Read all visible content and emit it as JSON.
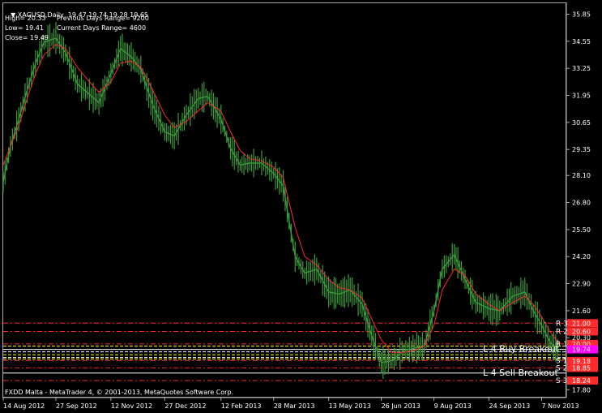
{
  "header": {
    "symbol_line": "XAGUSD,Daily  19.47 19.74 19.28 19.65",
    "high": "High= 20.33",
    "low": "Low= 19.41",
    "close": "Close= 19.49",
    "prev_range": "Previous Days Range= 9200",
    "curr_range": "Current Days Range= 4600"
  },
  "footer": {
    "credit": "FXDD Malta - MetaTrader 4, © 2001-2013, MetaQuotes Software Corp."
  },
  "colors": {
    "background": "#000000",
    "candle": "#3a9a3a",
    "ma": "#ff2a2a",
    "resistance": "#ff2a2a",
    "support": "#ff2a2a",
    "pivot_yellow": "#ffff00",
    "pivot_white": "#ffffff",
    "magenta": "#ff00ff"
  },
  "chart_data": {
    "type": "line",
    "y_ticks": [
      "35.85",
      "34.55",
      "33.25",
      "31.95",
      "30.65",
      "29.35",
      "28.10",
      "26.80",
      "25.50",
      "24.20",
      "22.90",
      "21.60",
      "20.30",
      "19.00",
      "17.80"
    ],
    "x_ticks": [
      "14 Aug 2012",
      "27 Sep 2012",
      "12 Nov 2012",
      "27 Dec 2012",
      "12 Feb 2013",
      "28 Mar 2013",
      "13 May 2013",
      "26 Jun 2013",
      "9 Aug 2013",
      "24 Sep 2013",
      "7 Nov 2013"
    ],
    "ylim": [
      17.5,
      36.3
    ],
    "price_x": [
      "14 Aug 2012",
      "20 Aug 2012",
      "27 Aug 2012",
      "3 Sep 2012",
      "10 Sep 2012",
      "17 Sep 2012",
      "27 Sep 2012",
      "5 Oct 2012",
      "15 Oct 2012",
      "25 Oct 2012",
      "2 Nov 2012",
      "12 Nov 2012",
      "20 Nov 2012",
      "29 Nov 2012",
      "7 Dec 2012",
      "17 Dec 2012",
      "27 Dec 2012",
      "4 Jan 2013",
      "14 Jan 2013",
      "24 Jan 2013",
      "1 Feb 2013",
      "12 Feb 2013",
      "20 Feb 2013",
      "28 Feb 2013",
      "8 Mar 2013",
      "18 Mar 2013",
      "28 Mar 2013",
      "5 Apr 2013",
      "15 Apr 2013",
      "23 Apr 2013",
      "3 May 2013",
      "13 May 2013",
      "22 May 2013",
      "31 May 2013",
      "10 Jun 2013",
      "18 Jun 2013",
      "26 Jun 2013",
      "5 Jul 2013",
      "15 Jul 2013",
      "24 Jul 2013",
      "1 Aug 2013",
      "9 Aug 2013",
      "16 Aug 2013",
      "26 Aug 2013",
      "4 Sep 2013",
      "13 Sep 2013",
      "24 Sep 2013",
      "3 Oct 2013",
      "14 Oct 2013",
      "24 Oct 2013",
      "31 Oct 2013",
      "7 Nov 2013",
      "14 Nov 2013",
      "22 Nov 2013"
    ],
    "price_y": [
      27.8,
      29.5,
      30.8,
      32.2,
      33.5,
      34.5,
      34.7,
      34.0,
      32.5,
      32.0,
      31.6,
      33.0,
      34.2,
      33.8,
      33.2,
      31.5,
      30.2,
      30.0,
      31.0,
      31.8,
      31.9,
      30.8,
      29.4,
      28.6,
      28.7,
      28.7,
      28.2,
      27.6,
      24.2,
      23.4,
      23.6,
      22.5,
      22.4,
      22.6,
      21.9,
      20.4,
      19.1,
      19.2,
      19.7,
      19.8,
      19.9,
      21.6,
      23.6,
      24.3,
      23.1,
      22.0,
      21.7,
      21.6,
      22.3,
      22.5,
      21.6,
      20.9,
      20.1,
      19.6
    ],
    "ma_y": [
      28.6,
      29.5,
      30.5,
      31.8,
      33.0,
      33.9,
      34.4,
      34.2,
      33.3,
      32.6,
      32.1,
      32.6,
      33.5,
      33.6,
      33.3,
      32.2,
      31.0,
      30.4,
      30.7,
      31.2,
      31.6,
      31.2,
      30.2,
      29.3,
      28.9,
      28.8,
      28.5,
      28.0,
      25.6,
      24.2,
      23.8,
      23.1,
      22.7,
      22.6,
      22.2,
      21.2,
      20.2,
      19.6,
      19.6,
      19.7,
      19.9,
      20.9,
      22.6,
      23.6,
      23.3,
      22.4,
      21.9,
      21.6,
      22.0,
      22.3,
      21.9,
      21.3,
      20.6,
      20.0
    ],
    "series": [
      {
        "name": "R 3",
        "value": 21.0
      },
      {
        "name": "R 2",
        "value": 20.6
      },
      {
        "name": "R 1",
        "value": 20.0
      },
      {
        "name": "L 4 Buy Breakout",
        "value": 19.74
      },
      {
        "name": "S 1",
        "value": 19.2
      },
      {
        "name": "S 2",
        "value": 18.85
      },
      {
        "name": "L 4 Sell Breakout",
        "value": 18.6
      },
      {
        "name": "S 3",
        "value": 18.24
      }
    ],
    "price_badges": [
      {
        "text": "21.00",
        "value": 21.0,
        "color": "#ff2a2a"
      },
      {
        "text": "20.60",
        "value": 20.6,
        "color": "#ff2a2a"
      },
      {
        "text": "20.00",
        "value": 20.0,
        "color": "#ff2a2a"
      },
      {
        "text": "19.74",
        "value": 19.74,
        "color": "#ff00ff"
      },
      {
        "text": "19.18",
        "value": 19.18,
        "color": "#ff2a2a"
      },
      {
        "text": "18.85",
        "value": 18.85,
        "color": "#ff2a2a"
      },
      {
        "text": "18.24",
        "value": 18.24,
        "color": "#ff2a2a"
      }
    ]
  }
}
